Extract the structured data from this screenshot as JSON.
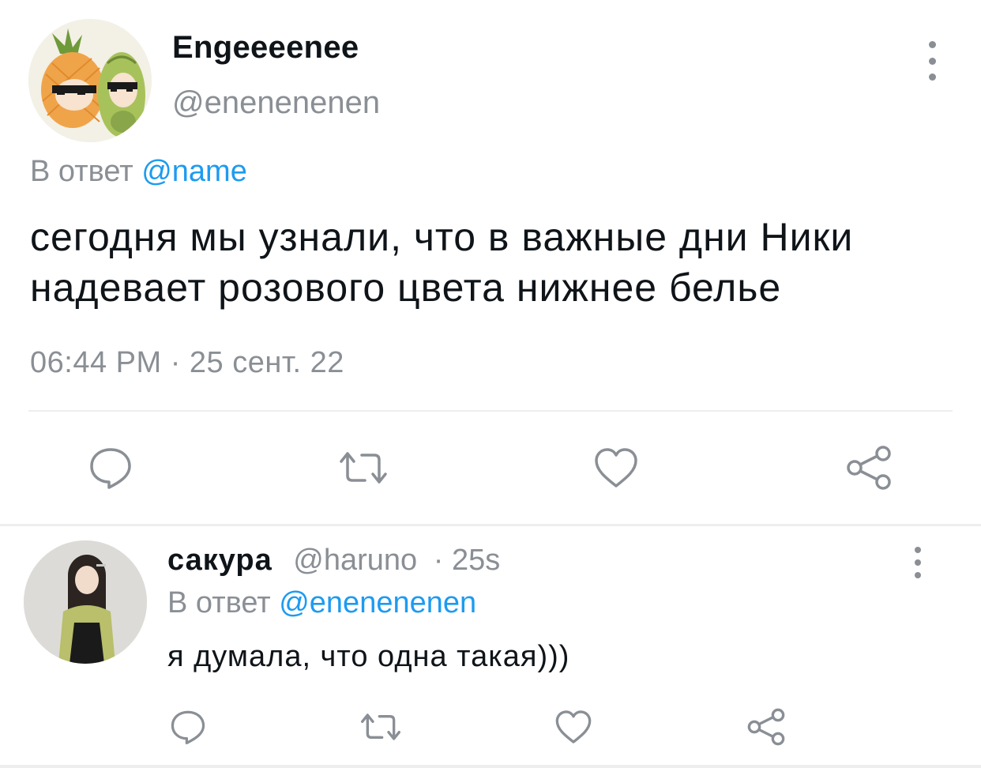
{
  "main_tweet": {
    "display_name": "Engeeeenee",
    "handle": "@enenenenen",
    "reply_prefix": "В ответ",
    "reply_mention": "@name",
    "text": "сегодня мы узнали, что в важные дни Ники надевает розового цвета нижнее белье",
    "timestamp": "06:44 PM · 25 сент. 22",
    "avatar_icon": "pineapple-and-avocado-avatar"
  },
  "reply_tweet": {
    "display_name": "сакура",
    "handle": "@haruno",
    "time": "· 25s",
    "reply_prefix": "В ответ",
    "reply_mention": "@enenenenen",
    "text": "я думала, что одна такая)))",
    "avatar_icon": "girl-photo-avatar"
  },
  "actions": [
    "reply-icon",
    "retweet-icon",
    "like-icon",
    "share-icon"
  ],
  "colors": {
    "text": "#0f1419",
    "secondary": "#8a8f95",
    "accent": "#1d9bf0",
    "divider": "#eceef0"
  }
}
